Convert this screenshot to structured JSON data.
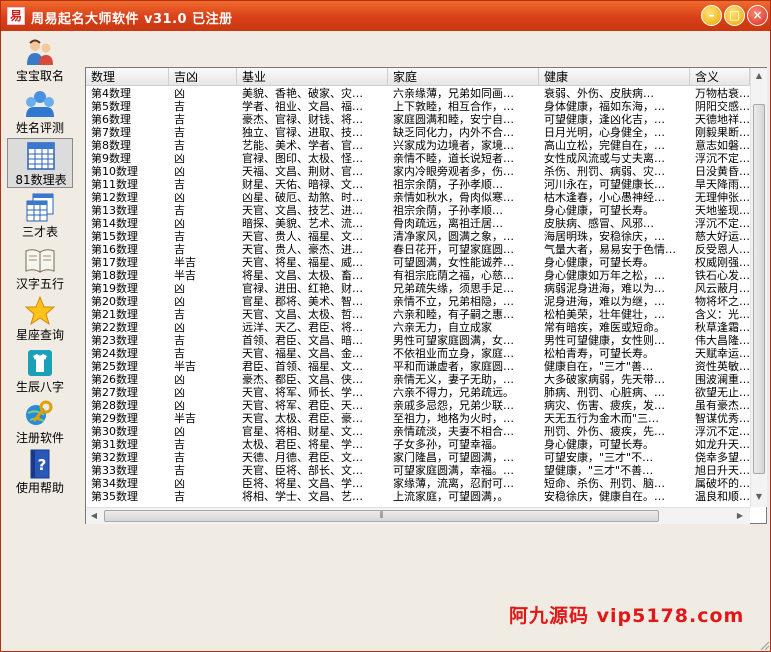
{
  "window": {
    "title": "周易起名大师软件 v31.0  已注册",
    "app_icon": "易",
    "buttons": {
      "minimize": "–",
      "maximize": "□",
      "close": "×"
    }
  },
  "sidebar": {
    "items": [
      {
        "label": "宝宝取名",
        "icon": "baby-couple-icon"
      },
      {
        "label": "姓名评测",
        "icon": "people-group-icon"
      },
      {
        "label": "81数理表",
        "icon": "grid-table-icon",
        "active": true
      },
      {
        "label": "三才表",
        "icon": "stacked-tables-icon"
      },
      {
        "label": "汉字五行",
        "icon": "open-book-icon"
      },
      {
        "label": "星座查询",
        "icon": "star-icon"
      },
      {
        "label": "生辰八字",
        "icon": "tshirt-icon"
      },
      {
        "label": "注册软件",
        "icon": "key-globe-icon"
      },
      {
        "label": "使用帮助",
        "icon": "help-book-icon"
      }
    ]
  },
  "table": {
    "columns": [
      "数理",
      "吉凶",
      "基业",
      "家庭",
      "健康",
      "含义"
    ],
    "rows": [
      [
        "第4数理",
        "凶",
        "美貌、香艳、破家、灾…",
        "六亲缘薄，兄弟如同画…",
        "衰弱、外伤、皮肤病…",
        "万物枯衰…"
      ],
      [
        "第5数理",
        "吉",
        "学者、祖业、文昌、福…",
        "上下敦睦，相互合作，…",
        "身体健康，福如东海，…",
        "阴阳交感…"
      ],
      [
        "第6数理",
        "吉",
        "豪杰、官禄、财钱、将…",
        "家庭圆满和睦，安宁自…",
        "可望健康，逢凶化吉，…",
        "天德地祥俱…"
      ],
      [
        "第7数理",
        "吉",
        "独立、官禄、进取、技…",
        "缺乏同化力，内外不合…",
        "日月光明，心身健全，…",
        "刚毅果断，单俗…"
      ],
      [
        "第8数理",
        "吉",
        "艺能、美术、学者、官…",
        "兴家成为边境者，家境…",
        "高山立松，完健自在，…",
        "意志如磐石…"
      ],
      [
        "第9数理",
        "凶",
        "官禄、图印、太极、怪…",
        "亲情不睦，道长说短者…",
        "女性成风流或与丈夫离…",
        "浮沉不定…"
      ],
      [
        "第10数理",
        "凶",
        "天福、文昌、荆财、官…",
        "家内冷眼旁观者多，伤…",
        "杀伤、刑罚、病弱、灾…",
        "日没黄昏…"
      ],
      [
        "第11数理",
        "吉",
        "财星、天佑、暗禄、文…",
        "祖宗余荫，子孙孝顺…",
        "河川永在，可望健康长…",
        "旱天降雨之…"
      ],
      [
        "第12数理",
        "凶",
        "凶星、破厄、劫煞、时…",
        "亲情如秋水，骨肉似寒…",
        "枯木逢春，小心愚神经…",
        "无理伸张…"
      ],
      [
        "第13数理",
        "吉",
        "天官、文昌、技艺、进…",
        "祖宗余荫，子孙孝顺…",
        "身心健康，可望长寿。",
        "天地鉴现…"
      ],
      [
        "第14数理",
        "凶",
        "暗探、美貌、艺术、流…",
        "骨肉疏远，离祖迁居…",
        "皮肤病、感冒、风邪…",
        "浮沉不定…"
      ],
      [
        "第15数理",
        "吉",
        "天官、贵人、福星、文…",
        "清净家风，圆满之象，…",
        "海居明珠，安稳徐庆，…",
        "慈大好运…"
      ],
      [
        "第16数理",
        "吉",
        "天官、贵人、豪杰、进…",
        "春日花开，可望家庭圆…",
        "气量大者，易易安于色情…",
        "反受恩人…"
      ],
      [
        "第17数理",
        "半吉",
        "天官、将星、福星、威…",
        "可望圆满，女性能诚养…",
        "身心健康，可望长寿。",
        "权威刚强…"
      ],
      [
        "第18数理",
        "半吉",
        "将星、文昌、太极、畜…",
        "有祖宗庇荫之福，心慈…",
        "身心健康如万年之松，…",
        "铁石心发达…"
      ],
      [
        "第19数理",
        "凶",
        "官禄、进田、红艳、财…",
        "兄弟疏失缘，须思手足…",
        "病弱泥身进海，难以为…",
        "风云蔽月…"
      ],
      [
        "第20数理",
        "凶",
        "官星、郡将、美术、智…",
        "亲情不立，兄弟相隐，…",
        "泥身进海，难以为继，…",
        "物将坏之象…"
      ],
      [
        "第21数理",
        "吉",
        "天官、文昌、太极、哲…",
        "六亲和睦，有子嗣之惠…",
        "松柏美荣，壮年健壮，…",
        "含义：光风…"
      ],
      [
        "第22数理",
        "凶",
        "远洋、天乙、君臣、将…",
        "六亲无力，自立成家",
        "常有暗疾，难医或短命。",
        "秋草逢霜之…"
      ],
      [
        "第23数理",
        "吉",
        "首领、君臣、文昌、暗…",
        "男性可望家庭圆满，女…",
        "男性可望健康，女性则…",
        "伟大昌隆之…"
      ],
      [
        "第24数理",
        "吉",
        "天官、福星、文昌、金…",
        "不依祖业而立身，家庭…",
        "松柏青寿，可望长寿。",
        "天赋幸运…"
      ],
      [
        "第25数理",
        "半吉",
        "君臣、首领、福星、文…",
        "平和而谦虚者，家庭圆…",
        "健康自在，\"三才\"善…",
        "资性英敏…"
      ],
      [
        "第26数理",
        "凶",
        "豪杰、都臣、文昌、侠…",
        "亲情无义，妻子无助，…",
        "大多破家病弱，先天带…",
        "围波澜重…"
      ],
      [
        "第27数理",
        "凶",
        "天官、将军、师长、学…",
        "六亲不得力，兄弟疏远。",
        "肺病、刑罚、心脏病、…",
        "欲望无止境…"
      ],
      [
        "第28数理",
        "凶",
        "天官、将军、君臣、天…",
        "亲戚多忌怨，兄弟少联…",
        "病灾、伤害、疲疾，发…",
        "虽有豪杰…"
      ],
      [
        "第29数理",
        "半吉",
        "天官、太极、君臣、豪…",
        "至祖力，地格为火时，…",
        "天无五行为金木而\"三…",
        "智谋优秀…"
      ],
      [
        "第30数理",
        "凶",
        "官星、将相、财星、文…",
        "亲情疏淡，夫妻不相合…",
        "刑罚、外伤、疲疾，先…",
        "浮沉不定…"
      ],
      [
        "第31数理",
        "吉",
        "太极、君臣、将星、学…",
        "子女多孙，可望幸福。",
        "身心健康，可望长寿。",
        "如龙升天…"
      ],
      [
        "第32数理",
        "吉",
        "天德、月德、君臣、文…",
        "家门隆昌，可望圆满，…",
        "可望安康，\"三才\"不…",
        "侥幸多望…"
      ],
      [
        "第33数理",
        "吉",
        "天官、臣将、部长、文…",
        "可望家庭圆满，幸福。…",
        "望健康，\"三才\"不善…",
        "旭日升天…"
      ],
      [
        "第34数理",
        "凶",
        "臣将、将星、文昌、学…",
        "家缘薄，流离，忍耐可…",
        "短命、杀伤、刑罚、脑…",
        "属破坏的之…"
      ],
      [
        "第35数理",
        "吉",
        "将相、学士、文昌、艺…",
        "上流家庭，可望圆满，。",
        "安稳徐庆，健康自在。…",
        "温良和顺之…"
      ]
    ]
  },
  "scroll": {
    "up": "▲",
    "down": "▼",
    "left": "◀",
    "right": "▶",
    "grip": "⦀"
  },
  "watermark": {
    "text": "阿九源码 vip5178.com"
  },
  "colors": {
    "titlebar": "#d8401a",
    "accent": "#e01818",
    "panel_bg": "#ffffff"
  }
}
